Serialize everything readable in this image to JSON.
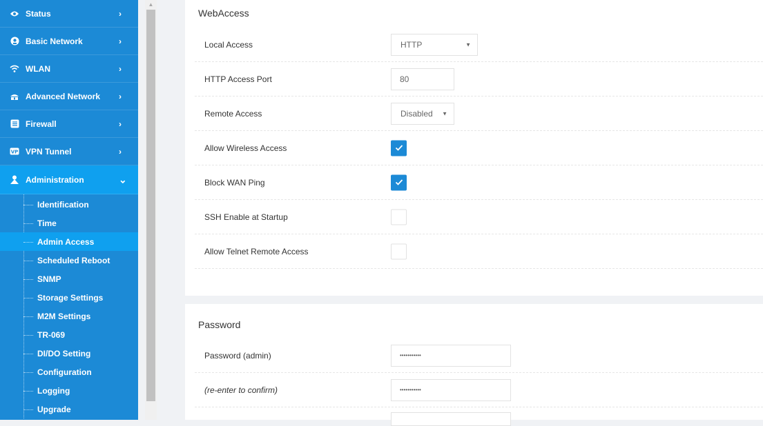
{
  "sidebar": {
    "nav": [
      {
        "label": "Status",
        "icon": "eye-icon",
        "arrow": "›"
      },
      {
        "label": "Basic Network",
        "icon": "globe-icon",
        "arrow": "›"
      },
      {
        "label": "WLAN",
        "icon": "wifi-icon",
        "arrow": "›"
      },
      {
        "label": "Advanced Network",
        "icon": "network-icon",
        "arrow": "›"
      },
      {
        "label": "Firewall",
        "icon": "firewall-icon",
        "arrow": "›"
      },
      {
        "label": "VPN Tunnel",
        "icon": "vpn-icon",
        "arrow": "›"
      },
      {
        "label": "Administration",
        "icon": "admin-icon",
        "arrow": "⌄"
      }
    ],
    "submenu": [
      "Identification",
      "Time",
      "Admin Access",
      "Scheduled Reboot",
      "SNMP",
      "Storage Settings",
      "M2M Settings",
      "TR-069",
      "DI/DO Setting",
      "Configuration",
      "Logging",
      "Upgrade"
    ],
    "current_submenu": "Admin Access"
  },
  "webaccess": {
    "title": "WebAccess",
    "local_access": {
      "label": "Local Access",
      "value": "HTTP"
    },
    "http_port": {
      "label": "HTTP Access Port",
      "value": "80"
    },
    "remote_access": {
      "label": "Remote Access",
      "value": "Disabled"
    },
    "allow_wireless": {
      "label": "Allow Wireless Access",
      "checked": true
    },
    "block_wan_ping": {
      "label": "Block WAN Ping",
      "checked": true
    },
    "ssh_startup": {
      "label": "SSH Enable at Startup",
      "checked": false
    },
    "telnet_remote": {
      "label": "Allow Telnet Remote Access",
      "checked": false
    }
  },
  "password": {
    "title": "Password",
    "admin": {
      "label": "Password (admin)",
      "value": "•••••••••••"
    },
    "confirm": {
      "label": "(re-enter to confirm)",
      "value": "•••••••••••"
    }
  },
  "colors": {
    "sidebar": "#1c8ad6",
    "active": "#0fa0ef",
    "checkbox": "#1c8ad6"
  }
}
